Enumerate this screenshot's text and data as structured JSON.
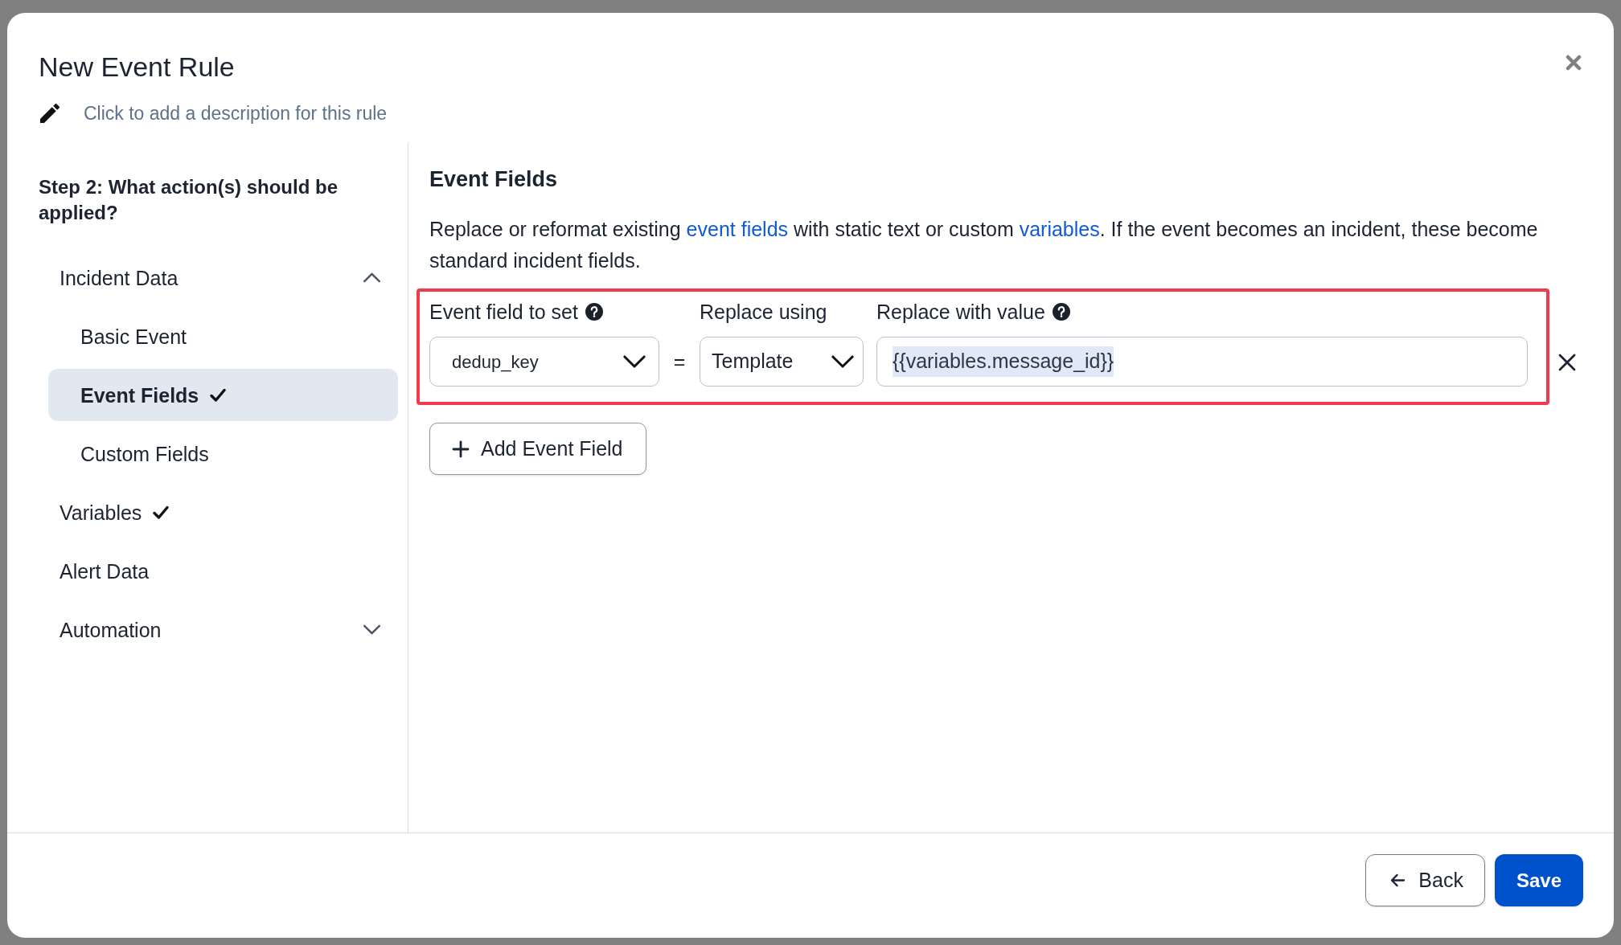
{
  "dialog": {
    "title": "New Event Rule",
    "description_prompt": "Click to add a description for this rule"
  },
  "sidebar": {
    "heading": "Step 2: What action(s) should be applied?",
    "items": [
      {
        "label": "Incident Data",
        "selected": false,
        "completed": false,
        "expanded": true,
        "children": [
          {
            "label": "Basic Event",
            "selected": false,
            "completed": false
          },
          {
            "label": "Event Fields",
            "selected": true,
            "completed": true
          },
          {
            "label": "Custom Fields",
            "selected": false,
            "completed": false
          }
        ]
      },
      {
        "label": "Variables",
        "selected": false,
        "completed": true
      },
      {
        "label": "Alert Data",
        "selected": false,
        "completed": false
      },
      {
        "label": "Automation",
        "selected": false,
        "completed": false,
        "expanded": false
      }
    ]
  },
  "main": {
    "heading": "Event Fields",
    "description": [
      {
        "kind": "text",
        "text": "Replace or reformat existing "
      },
      {
        "kind": "link",
        "text": "event fields"
      },
      {
        "kind": "text",
        "text": " with static text or custom "
      },
      {
        "kind": "link",
        "text": "variables"
      },
      {
        "kind": "text",
        "text": ". If the event becomes an incident, these become standard incident fields."
      }
    ],
    "field_editor": {
      "highlighted": true,
      "columns": [
        {
          "label": "Event field to set",
          "help": true
        },
        {
          "label": "Replace using",
          "help": false
        },
        {
          "label": "Replace with value",
          "help": true
        }
      ],
      "rows": [
        {
          "field": "dedup_key",
          "operator": "=",
          "replace_using": "Template",
          "value": "{{variables.message_id}}",
          "value_selected": true
        }
      ]
    },
    "add_button": "Add Event Field"
  },
  "footer": {
    "buttons": [
      {
        "kind": "back",
        "label": "Back"
      },
      {
        "kind": "primary",
        "label": "Save"
      }
    ]
  }
}
